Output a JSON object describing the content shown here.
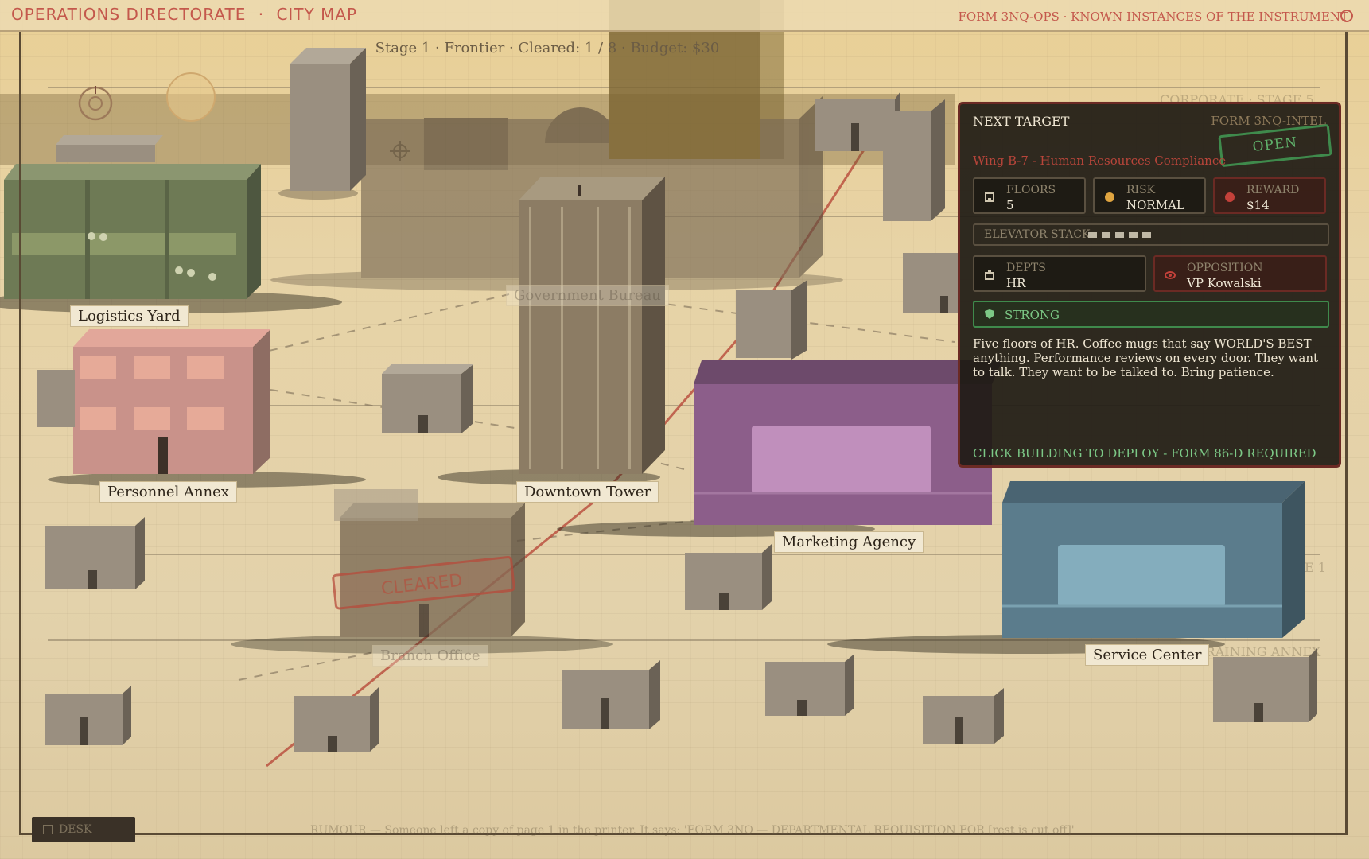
{
  "header": {
    "left_title": "OPERATIONS DIRECTORATE",
    "left_sep": "·",
    "left_section": "CITY MAP",
    "right_text": "FORM 3NQ-OPS · KNOWN INSTANCES OF THE INSTRUMENT"
  },
  "status_bar": "Stage 1 · Frontier · Cleared: 1 / 8 · Budget: $30",
  "buildings": [
    {
      "label": "Logistics Yard"
    },
    {
      "label": "Personnel Annex"
    },
    {
      "label": "Downtown Tower"
    },
    {
      "label": "Marketing Agency"
    },
    {
      "label": "Service Center"
    },
    {
      "label": "Government Bureau"
    },
    {
      "label": "Branch Office"
    }
  ],
  "ghost_labels": {
    "corporate": "CORPORATE · STAGE 5",
    "training": "TRAINING ANNEX",
    "stage_edge": "E 1",
    "cleared_stamp": "CLEARED"
  },
  "panel": {
    "title": "NEXT TARGET",
    "form": "FORM 3NQ-INTEL",
    "stamp": "OPEN",
    "subtitle": "Wing B-7 - Human Resources Compliance",
    "floors_label": "FLOORS",
    "floors_value": "5",
    "risk_label": "RISK",
    "risk_value": "NORMAL",
    "reward_label": "REWARD",
    "reward_value": "$14",
    "elevator_label": "ELEVATOR STACK",
    "elevator_count": 5,
    "depts_label": "DEPTS",
    "depts_value": "HR",
    "opposition_label": "OPPOSITION",
    "opposition_value": "VP Kowalski",
    "strength": "STRONG",
    "description": "Five floors of HR. Coffee mugs that say WORLD'S BEST anything. Performance reviews on every door. They want to talk. They want to be talked to. Bring patience.",
    "cta": "CLICK BUILDING TO DEPLOY - FORM 86-D REQUIRED"
  },
  "footer": {
    "desk_button": "DESK",
    "rumour": "RUMOUR — Someone left a copy of page 1 in the printer. It says: 'FORM 3NQ — DEPARTMENTAL REQUISITION FOR [rest is cut off]'"
  },
  "colors": {
    "accent_red": "#c4584c",
    "panel_bg": "#1e1a14",
    "ok_green": "#7cc886"
  }
}
